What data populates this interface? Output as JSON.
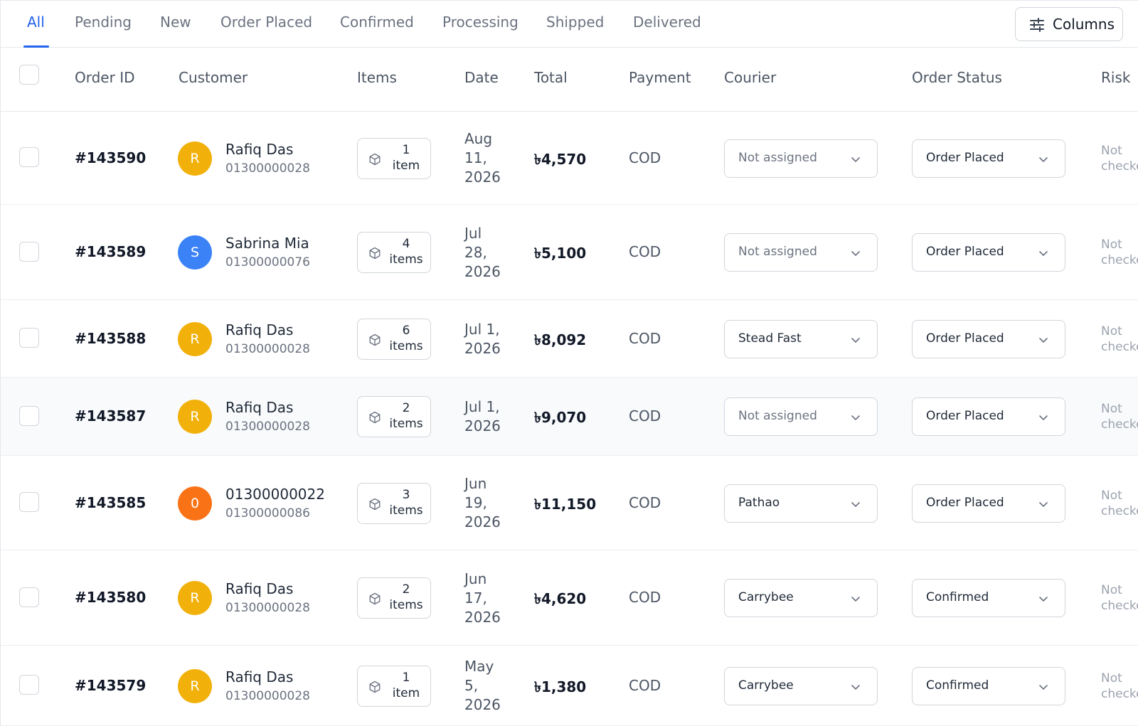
{
  "tabs": [
    {
      "label": "All",
      "active": true
    },
    {
      "label": "Pending"
    },
    {
      "label": "New"
    },
    {
      "label": "Order Placed"
    },
    {
      "label": "Confirmed"
    },
    {
      "label": "Processing"
    },
    {
      "label": "Shipped"
    },
    {
      "label": "Delivered"
    }
  ],
  "toolbar": {
    "columns_label": "Columns",
    "columns_icon": "sliders-icon"
  },
  "columns": [
    "Order ID",
    "Customer",
    "Items",
    "Date",
    "Total",
    "Payment",
    "Courier",
    "Order Status",
    "Risk"
  ],
  "colors": {
    "accent": "#2563eb",
    "amber": "#f2b10a",
    "blue": "#3b82f6",
    "orange": "#f97316"
  },
  "orders": [
    {
      "id": "#143590",
      "avatar": "R",
      "avatar_color": "#f2b10a",
      "name": "Rafiq Das",
      "phone": "01300000028",
      "item_count": "1",
      "item_unit": "item",
      "date_lines": [
        "Aug",
        "11,",
        "2026"
      ],
      "total": "৳4,570",
      "payment": "COD",
      "courier": "Not assigned",
      "courier_assigned": false,
      "status": "Order Placed",
      "risk": [
        "Not",
        "checked"
      ]
    },
    {
      "id": "#143589",
      "avatar": "S",
      "avatar_color": "#3b82f6",
      "name": "Sabrina Mia",
      "phone": "01300000076",
      "item_count": "4",
      "item_unit": "items",
      "date_lines": [
        "Jul",
        "28,",
        "2026"
      ],
      "total": "৳5,100",
      "payment": "COD",
      "courier": "Not assigned",
      "courier_assigned": false,
      "status": "Order Placed",
      "risk": [
        "Not",
        "checked"
      ]
    },
    {
      "id": "#143588",
      "avatar": "R",
      "avatar_color": "#f2b10a",
      "name": "Rafiq Das",
      "phone": "01300000028",
      "item_count": "6",
      "item_unit": "items",
      "date_lines": [
        "Jul 1,",
        "2026"
      ],
      "total": "৳8,092",
      "payment": "COD",
      "courier": "Stead Fast",
      "courier_assigned": true,
      "status": "Order Placed",
      "risk": [
        "Not",
        "checked"
      ]
    },
    {
      "id": "#143587",
      "avatar": "R",
      "avatar_color": "#f2b10a",
      "name": "Rafiq Das",
      "phone": "01300000028",
      "item_count": "2",
      "item_unit": "items",
      "date_lines": [
        "Jul 1,",
        "2026"
      ],
      "total": "৳9,070",
      "payment": "COD",
      "courier": "Not assigned",
      "courier_assigned": false,
      "status": "Order Placed",
      "risk": [
        "Not",
        "checked"
      ]
    },
    {
      "id": "#143585",
      "avatar": "0",
      "avatar_color": "#f97316",
      "name": "01300000022",
      "phone": "01300000086",
      "item_count": "3",
      "item_unit": "items",
      "date_lines": [
        "Jun",
        "19,",
        "2026"
      ],
      "total": "৳11,150",
      "payment": "COD",
      "courier": "Pathao",
      "courier_assigned": true,
      "status": "Order Placed",
      "risk": [
        "Not",
        "checked"
      ]
    },
    {
      "id": "#143580",
      "avatar": "R",
      "avatar_color": "#f2b10a",
      "name": "Rafiq Das",
      "phone": "01300000028",
      "item_count": "2",
      "item_unit": "items",
      "date_lines": [
        "Jun",
        "17,",
        "2026"
      ],
      "total": "৳4,620",
      "payment": "COD",
      "courier": "Carrybee",
      "courier_assigned": true,
      "status": "Confirmed",
      "risk": [
        "Not",
        "checked"
      ]
    },
    {
      "id": "#143579",
      "avatar": "R",
      "avatar_color": "#f2b10a",
      "name": "Rafiq Das",
      "phone": "01300000028",
      "item_count": "1",
      "item_unit": "item",
      "date_lines": [
        "May",
        "5,",
        "2026"
      ],
      "total": "৳1,380",
      "payment": "COD",
      "courier": "Carrybee",
      "courier_assigned": true,
      "status": "Confirmed",
      "risk": [
        "Not",
        "checked"
      ]
    }
  ]
}
